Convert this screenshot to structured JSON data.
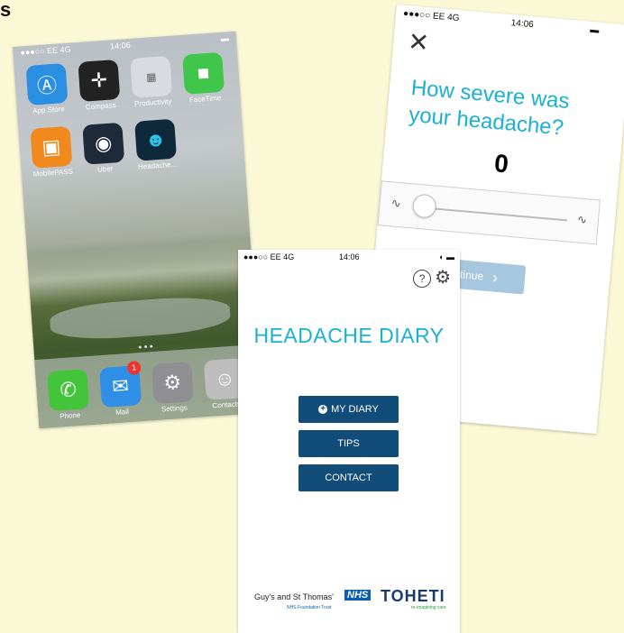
{
  "slide": {
    "title": "s"
  },
  "home": {
    "status": {
      "carrier": "●●●○○ EE 4G",
      "time": "14:06"
    },
    "apps": [
      {
        "label": "App Store",
        "icon": "app-store-icon",
        "color": "#2a8fe0"
      },
      {
        "label": "Compass",
        "icon": "compass-icon",
        "color": "#222222"
      },
      {
        "label": "Productivity",
        "icon": "folder-icon",
        "color": "#d9dbe0"
      },
      {
        "label": "FaceTime",
        "icon": "facetime-icon",
        "color": "#3fc64a"
      },
      {
        "label": "MobilePASS",
        "icon": "mobilepass-icon",
        "color": "#f08a1e"
      },
      {
        "label": "Uber",
        "icon": "uber-icon",
        "color": "#1e2a3a"
      },
      {
        "label": "Headache...",
        "icon": "headache-icon",
        "color": "#0e2a3a"
      }
    ],
    "dock": [
      {
        "label": "Phone",
        "icon": "phone-icon",
        "color": "#43c43a"
      },
      {
        "label": "Mail",
        "icon": "mail-icon",
        "color": "#2f8ee5",
        "badge": "1"
      },
      {
        "label": "Settings",
        "icon": "settings-icon",
        "color": "#8e8e93"
      },
      {
        "label": "Contacts",
        "icon": "contacts-icon",
        "color": "#bdbdbd"
      }
    ]
  },
  "diary": {
    "status": {
      "carrier": "●●●○○ EE 4G",
      "time": "14:06"
    },
    "title": "HEADACHE DIARY",
    "buttons": {
      "my_diary": "MY DIARY",
      "tips": "TIPS",
      "contact": "CONTACT"
    },
    "footer": {
      "gst": "Guy's and St Thomas'",
      "nhs": "NHS",
      "nhs_sub": "NHS Foundation Trust",
      "toheti": "TOHETI",
      "toheti_sub": "re-imagining care"
    },
    "colors": {
      "accent": "#1bb1d0",
      "button": "#124d7a"
    }
  },
  "severity": {
    "status": {
      "carrier": "●●●○○ EE 4G",
      "time": "14:06"
    },
    "question": "How severe was your headache?",
    "value": "0",
    "slider_level": 0,
    "continue_label": "Continue"
  }
}
